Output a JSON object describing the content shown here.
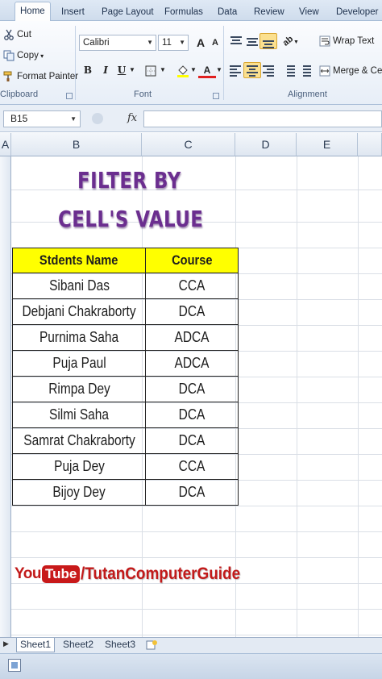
{
  "tabs": [
    "Home",
    "Insert",
    "Page Layout",
    "Formulas",
    "Data",
    "Review",
    "View",
    "Developer"
  ],
  "clipboard": {
    "cut": "Cut",
    "copy": "Copy",
    "format_painter": "Format Painter",
    "label": "Clipboard"
  },
  "font": {
    "name": "Calibri",
    "size": "11",
    "bold": "B",
    "italic": "I",
    "underline": "U",
    "label": "Font",
    "grow": "A",
    "shrink": "A"
  },
  "alignment": {
    "wrap": "Wrap Text",
    "merge": "Merge & Cen",
    "label": "Alignment"
  },
  "formula_bar": {
    "name_box": "B15",
    "fx": "fx",
    "value": ""
  },
  "columns": [
    "A",
    "B",
    "C",
    "D",
    "E"
  ],
  "sheet": {
    "title_line1": "FILTER BY",
    "title_line2": "CELL'S VALUE",
    "headers": [
      "Stdents Name",
      "Course"
    ],
    "rows": [
      [
        "Sibani Das",
        "CCA"
      ],
      [
        "Debjani Chakraborty",
        "DCA"
      ],
      [
        "Purnima Saha",
        "ADCA"
      ],
      [
        "Puja Paul",
        "ADCA"
      ],
      [
        "Rimpa Dey",
        "DCA"
      ],
      [
        "Silmi Saha",
        "DCA"
      ],
      [
        "Samrat Chakraborty",
        "DCA"
      ],
      [
        "Puja Dey",
        "CCA"
      ],
      [
        "Bijoy Dey",
        "DCA"
      ]
    ],
    "brand_you": "You",
    "brand_tube": "Tube",
    "brand_text": "/TutanComputerGuide"
  },
  "sheet_tabs": [
    "Sheet1",
    "Sheet2",
    "Sheet3"
  ],
  "colors": {
    "title": "#6b2e8f",
    "header_fill": "#ffff00",
    "brand": "#c21a1a"
  }
}
